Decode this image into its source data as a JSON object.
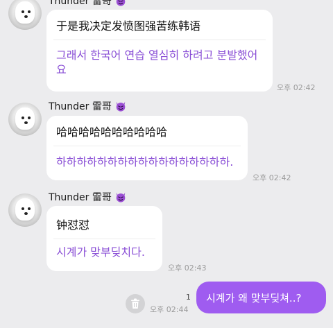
{
  "messages": [
    {
      "sender": "Thunder 雷哥",
      "original": "于是我决定发愤图强苦练韩语",
      "translation": "그래서 한국어 연습 열심히 하려고 분발했어요",
      "time": "오후 02:42"
    },
    {
      "sender": "Thunder 雷哥",
      "original": "哈哈哈哈哈哈哈哈哈哈",
      "translation": "하하하하하하하하하하하하하하하하하.",
      "time": "오후 02:42"
    },
    {
      "sender": "Thunder 雷哥",
      "original": "钟怼怼",
      "translation": "시계가 맞부딪치다.",
      "time": "오후 02:43"
    }
  ],
  "outgoing": {
    "text": "시계가 왜 맞부딪쳐..?",
    "unread_count": "1",
    "time": "오후 02:44"
  },
  "icons": {
    "sender_emoji": "purple-devil-icon",
    "trash": "trash-icon"
  },
  "colors": {
    "background": "#ececee",
    "translation_text": "#8a4fd6",
    "outgoing_bubble": "#9f5cf0"
  }
}
